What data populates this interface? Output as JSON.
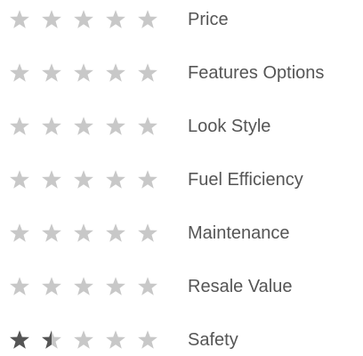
{
  "colors": {
    "star_empty": "#c8c8c8",
    "star_filled": "#555555",
    "label_text": "#555555"
  },
  "star_icon": "star-icon",
  "max_stars": 5,
  "ratings": [
    {
      "label": "Price",
      "value": 0
    },
    {
      "label": "Features Options",
      "value": 0
    },
    {
      "label": "Look Style",
      "value": 0
    },
    {
      "label": "Fuel Efficiency",
      "value": 0
    },
    {
      "label": "Maintenance",
      "value": 0
    },
    {
      "label": "Resale Value",
      "value": 0
    },
    {
      "label": "Safety",
      "value": 1.5
    }
  ]
}
